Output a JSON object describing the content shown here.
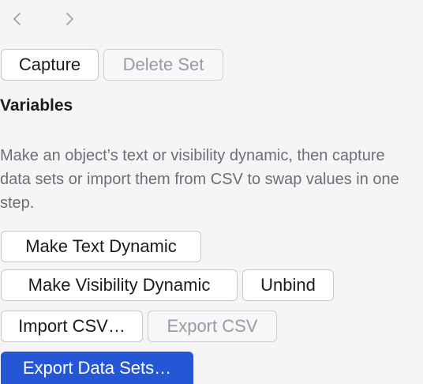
{
  "toolbar": {
    "capture_label": "Capture",
    "delete_set_label": "Delete Set"
  },
  "variables": {
    "title": "Variables",
    "description": "Make an object’s text or visibility dynamic, then capture data sets or import them from CSV to swap values in one step.",
    "make_text_dynamic_label": "Make Text Dynamic",
    "make_visibility_dynamic_label": "Make Visibility Dynamic",
    "unbind_label": "Unbind",
    "import_csv_label": "Import CSV…",
    "export_csv_label": "Export CSV",
    "export_data_sets_label": "Export Data Sets…"
  },
  "icons": {
    "back": "chevron-left-icon",
    "forward": "chevron-right-icon"
  },
  "colors": {
    "accent": "#2456d6",
    "background": "#f5f5f7",
    "disabled_text": "#9a9aa0"
  }
}
